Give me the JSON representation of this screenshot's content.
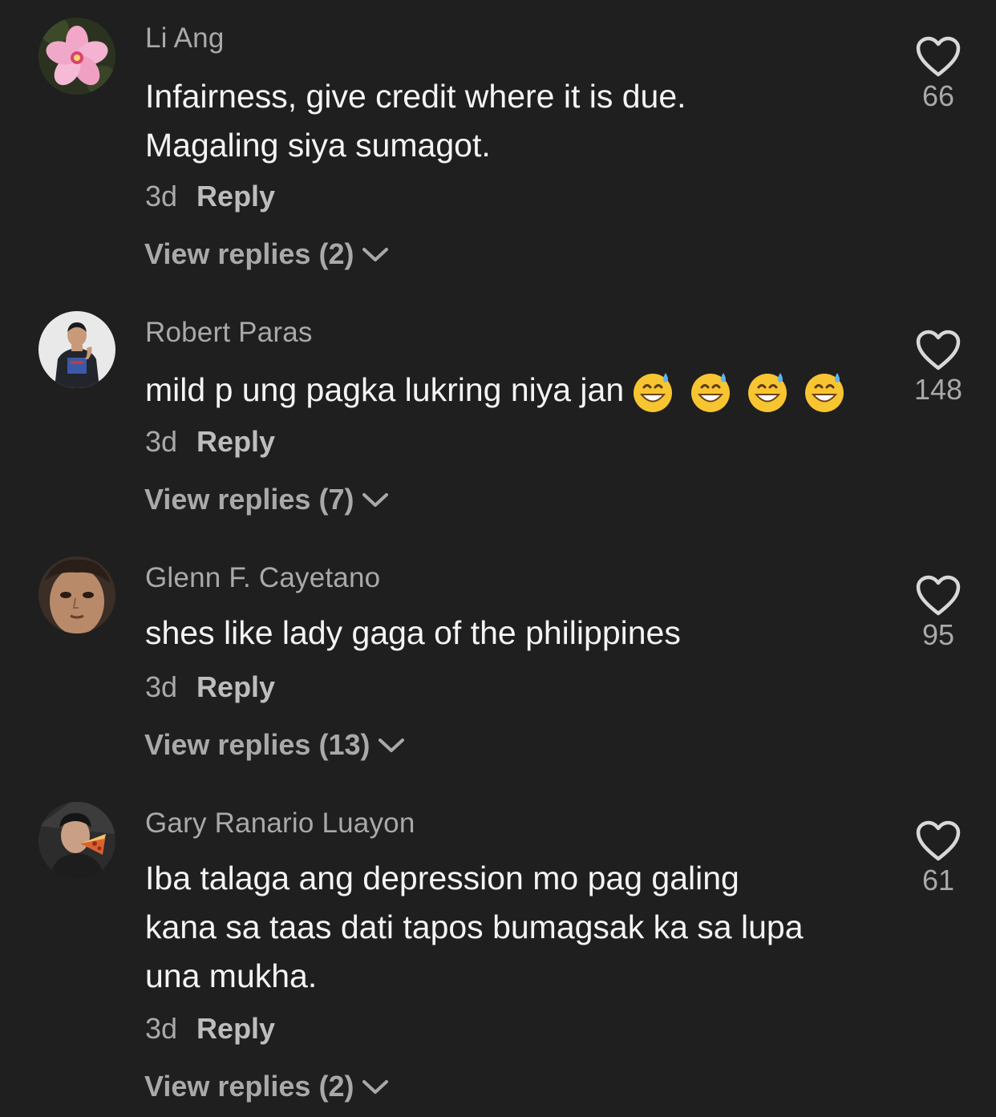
{
  "comments": [
    {
      "author": "Li Ang",
      "lines": [
        "Infairness, give credit where it is due.",
        "Magaling siya sumagot."
      ],
      "time": "3d",
      "reply_label": "Reply",
      "view_replies": "View replies (2)",
      "likes": "66",
      "avatar_icon": "pink-flower-avatar"
    },
    {
      "author": "Robert Paras",
      "lines": [
        "mild p ung pagka lukring niya jan"
      ],
      "emojis": [
        "grinning-sweat-emoji",
        "grinning-sweat-emoji",
        "grinning-sweat-emoji",
        "grinning-sweat-emoji"
      ],
      "time": "3d",
      "reply_label": "Reply",
      "view_replies": "View replies (7)",
      "likes": "148",
      "avatar_icon": "man-portrait-avatar"
    },
    {
      "author": "Glenn F. Cayetano",
      "lines": [
        "shes like lady gaga of the philippines"
      ],
      "time": "3d",
      "reply_label": "Reply",
      "view_replies": "View replies (13)",
      "likes": "95",
      "avatar_icon": "face-closeup-avatar"
    },
    {
      "author": "Gary Ranario Luayon",
      "lines": [
        "Iba talaga ang depression mo pag galing",
        "kana sa taas dati tapos bumagsak ka sa lupa",
        "una mukha."
      ],
      "time": "3d",
      "reply_label": "Reply",
      "view_replies": "View replies (2)",
      "likes": "61",
      "avatar_icon": "man-eating-pizza-avatar"
    }
  ],
  "colors": {
    "background": "#1f1f1f",
    "author": "#a9a9a9",
    "text": "#f4f4f4",
    "secondary": "#a9a9a9"
  }
}
